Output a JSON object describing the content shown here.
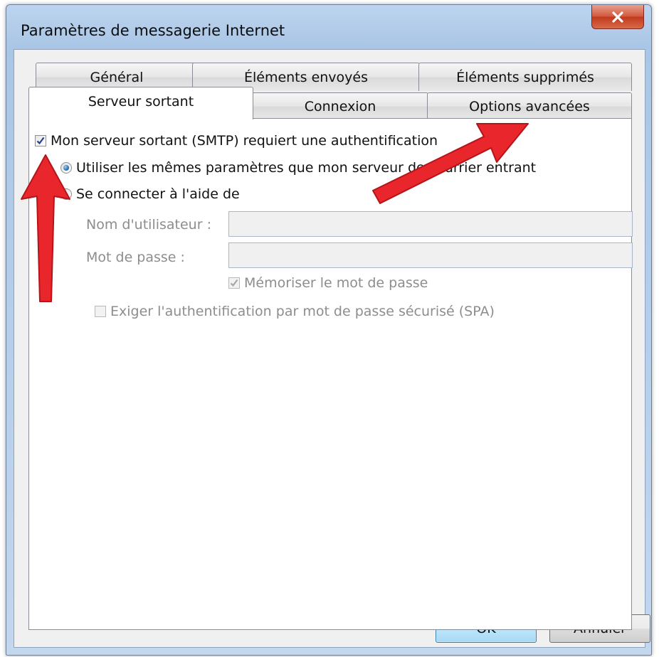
{
  "window": {
    "title": "Paramètres de messagerie Internet"
  },
  "tabs": {
    "back_row": [
      "Général",
      "Éléments envoyés",
      "Éléments supprimés"
    ],
    "front_row": [
      "Serveur sortant",
      "Connexion",
      "Options avancées"
    ],
    "active": "Serveur sortant"
  },
  "outgoing": {
    "auth_required_label": "Mon serveur sortant (SMTP) requiert une authentification",
    "auth_required_checked": true,
    "radio_same_label": "Utiliser les mêmes paramètres que mon serveur de courrier entrant",
    "radio_same_selected": true,
    "radio_login_label": "Se connecter à l'aide de",
    "username_label": "Nom d'utilisateur :",
    "username_value": "",
    "password_label": "Mot de passe :",
    "password_value": "",
    "remember_label": "Mémoriser le mot de passe",
    "remember_checked": true,
    "spa_label": "Exiger l'authentification par mot de passe sécurisé (SPA)",
    "spa_checked": false
  },
  "buttons": {
    "ok": "OK",
    "cancel": "Annuler"
  },
  "colors": {
    "annotation_arrow": "#e8262c",
    "close_button": "#c9452a",
    "window_frame": "#aac6e6"
  }
}
